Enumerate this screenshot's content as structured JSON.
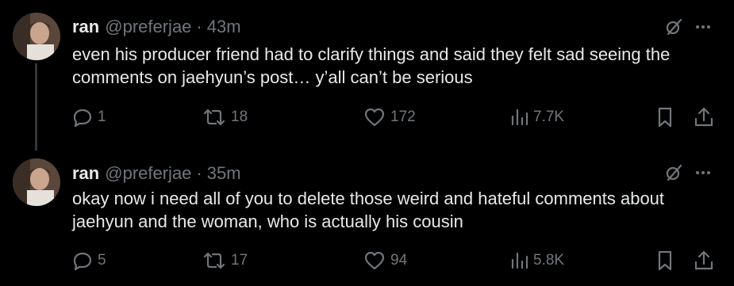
{
  "tweets": [
    {
      "author_name": "ran",
      "handle": "@preferjae",
      "separator": "·",
      "time": "43m",
      "text": "even his producer friend had to clarify things and said they felt sad seeing the comments on jaehyun’s post… y’all can’t be serious",
      "replies": "1",
      "retweets": "18",
      "likes": "172",
      "views": "7.7K",
      "has_thread_line": true
    },
    {
      "author_name": "ran",
      "handle": "@preferjae",
      "separator": "·",
      "time": "35m",
      "text": "okay now i need all of you to delete those weird and hateful comments about jaehyun and the woman, who is actually his cousin",
      "replies": "5",
      "retweets": "17",
      "likes": "94",
      "views": "5.8K",
      "has_thread_line": false
    }
  ],
  "icons": {
    "reply": "reply-icon",
    "retweet": "retweet-icon",
    "like": "heart-icon",
    "views": "views-icon",
    "bookmark": "bookmark-icon",
    "share": "share-icon",
    "more": "more-icon",
    "grok": "grok-icon"
  },
  "colors": {
    "background": "#000000",
    "primary_text": "#e7e9ea",
    "secondary_text": "#71767b",
    "thread_line": "#333639"
  }
}
